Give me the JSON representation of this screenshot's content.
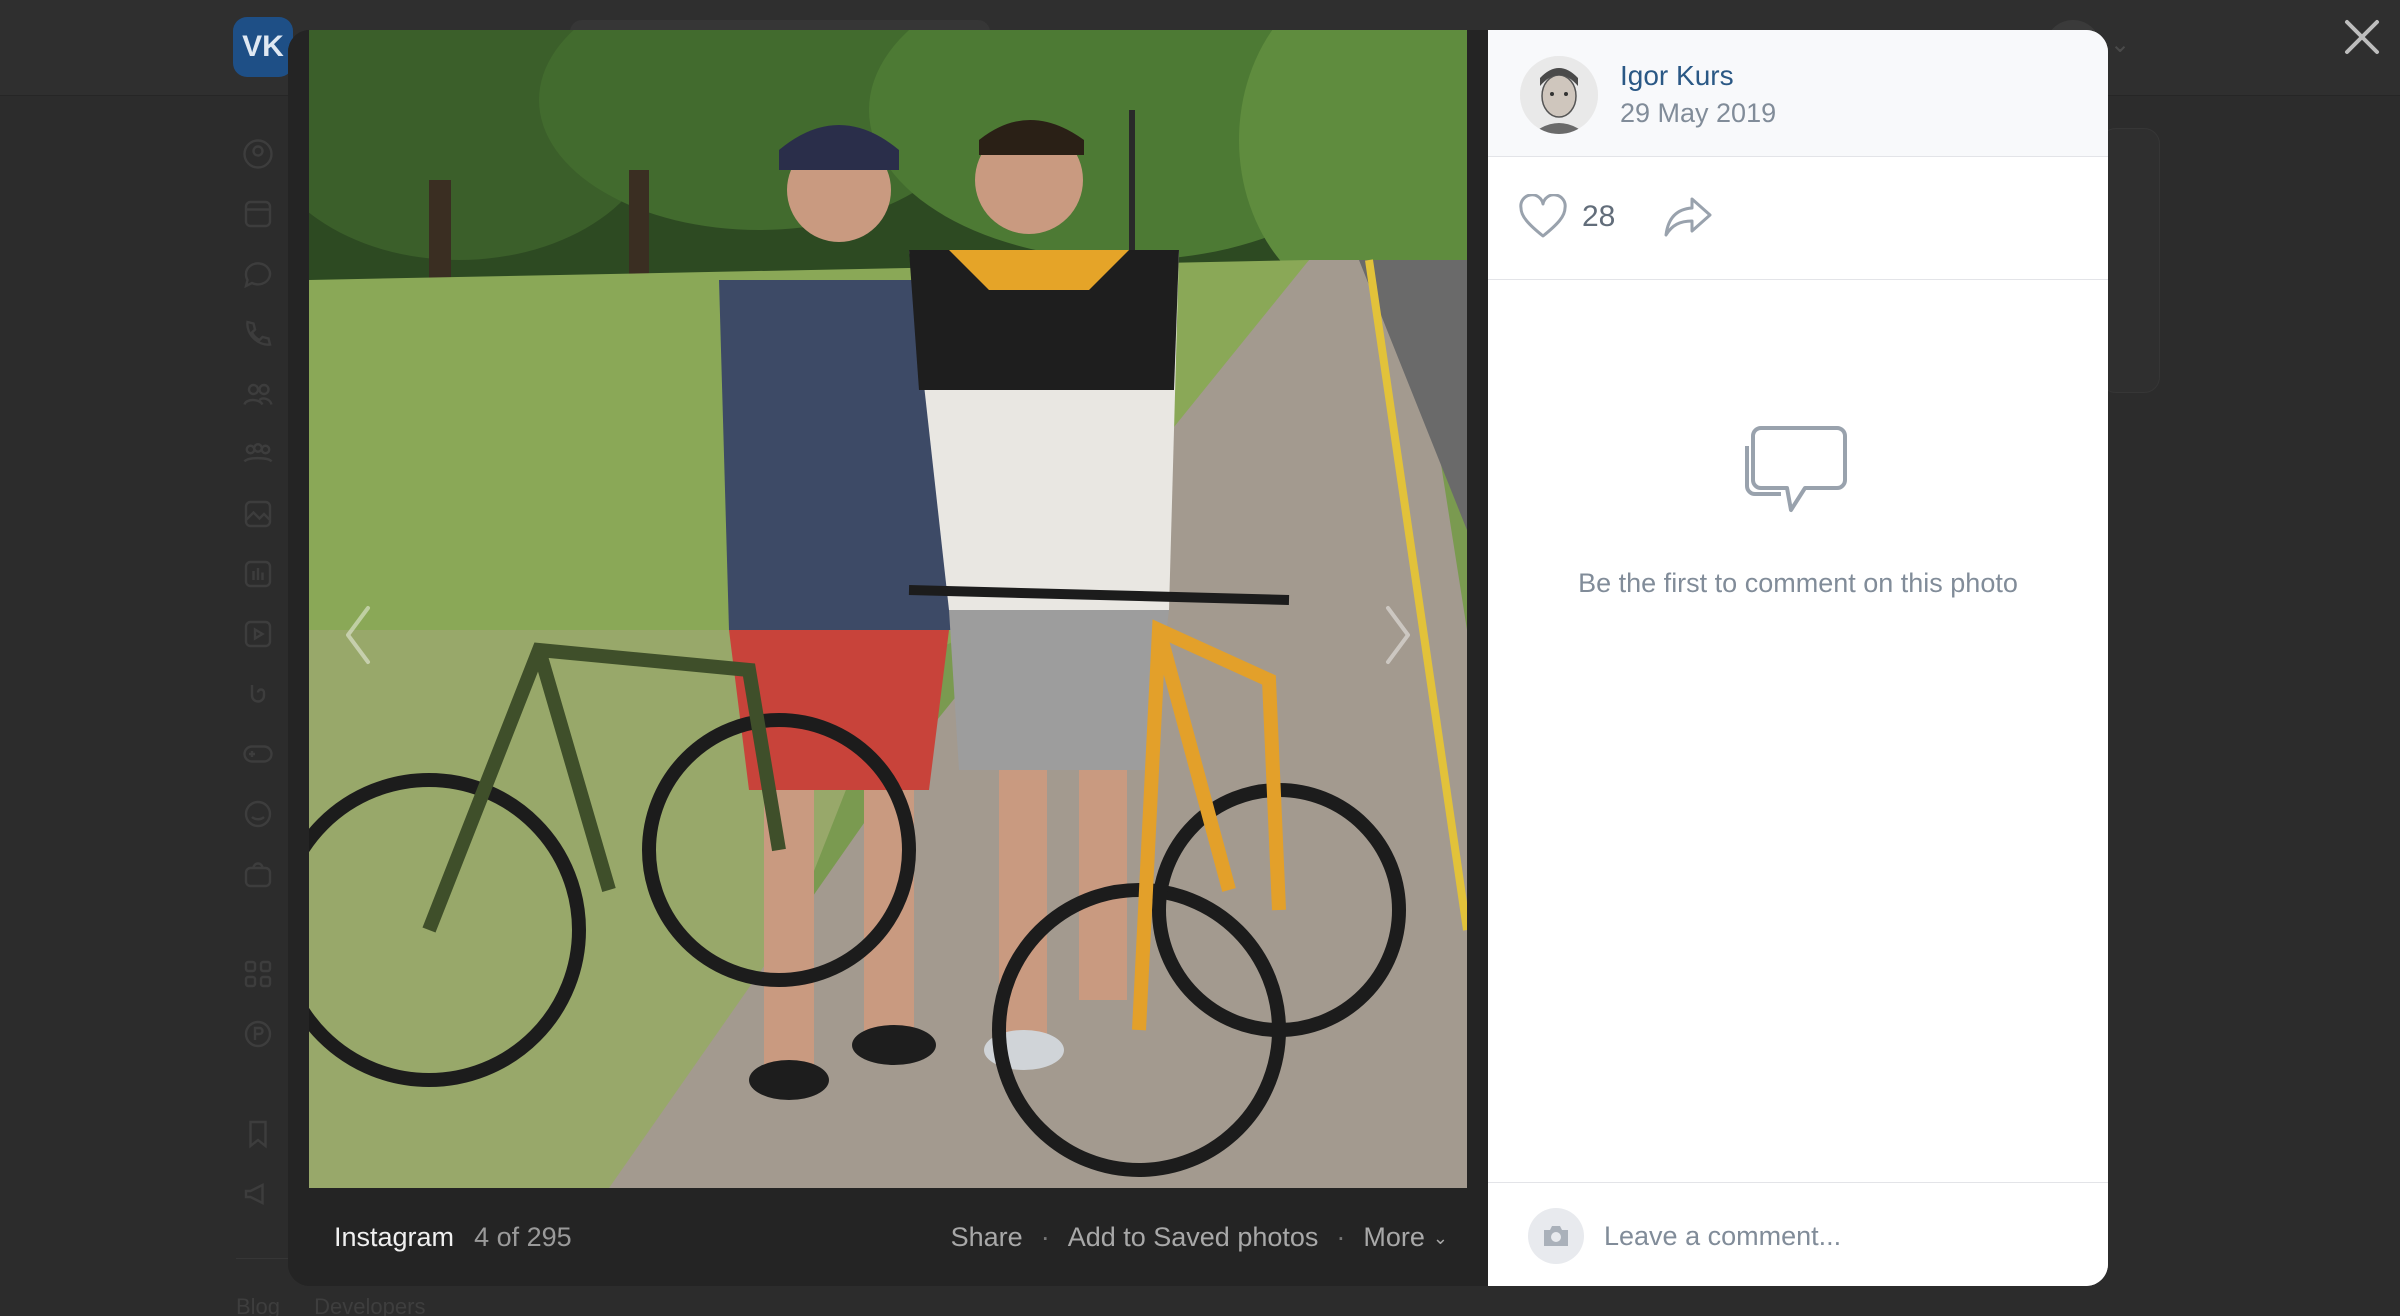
{
  "background": {
    "logo_text": "VK",
    "footer_links": [
      "Blog",
      "Developers"
    ]
  },
  "viewer": {
    "album_name": "Instagram",
    "counter": "4 of 295",
    "actions": {
      "share": "Share",
      "save": "Add to Saved photos",
      "more": "More"
    }
  },
  "post": {
    "author_name": "Igor Kurs",
    "date": "29 May 2019",
    "likes": "28"
  },
  "comments": {
    "empty_text": "Be the first to comment on this photo",
    "placeholder": "Leave a comment..."
  },
  "icons": {
    "close": "close-icon",
    "like": "heart-icon",
    "share": "share-arrow-icon",
    "comments": "comments-bubbles-icon",
    "camera": "camera-icon",
    "prev": "chevron-left-icon",
    "next": "chevron-right-icon",
    "more": "chevron-down-icon"
  },
  "colors": {
    "link": "#2a5885",
    "muted": "#818c99",
    "overlay": "#2c2c2c"
  }
}
